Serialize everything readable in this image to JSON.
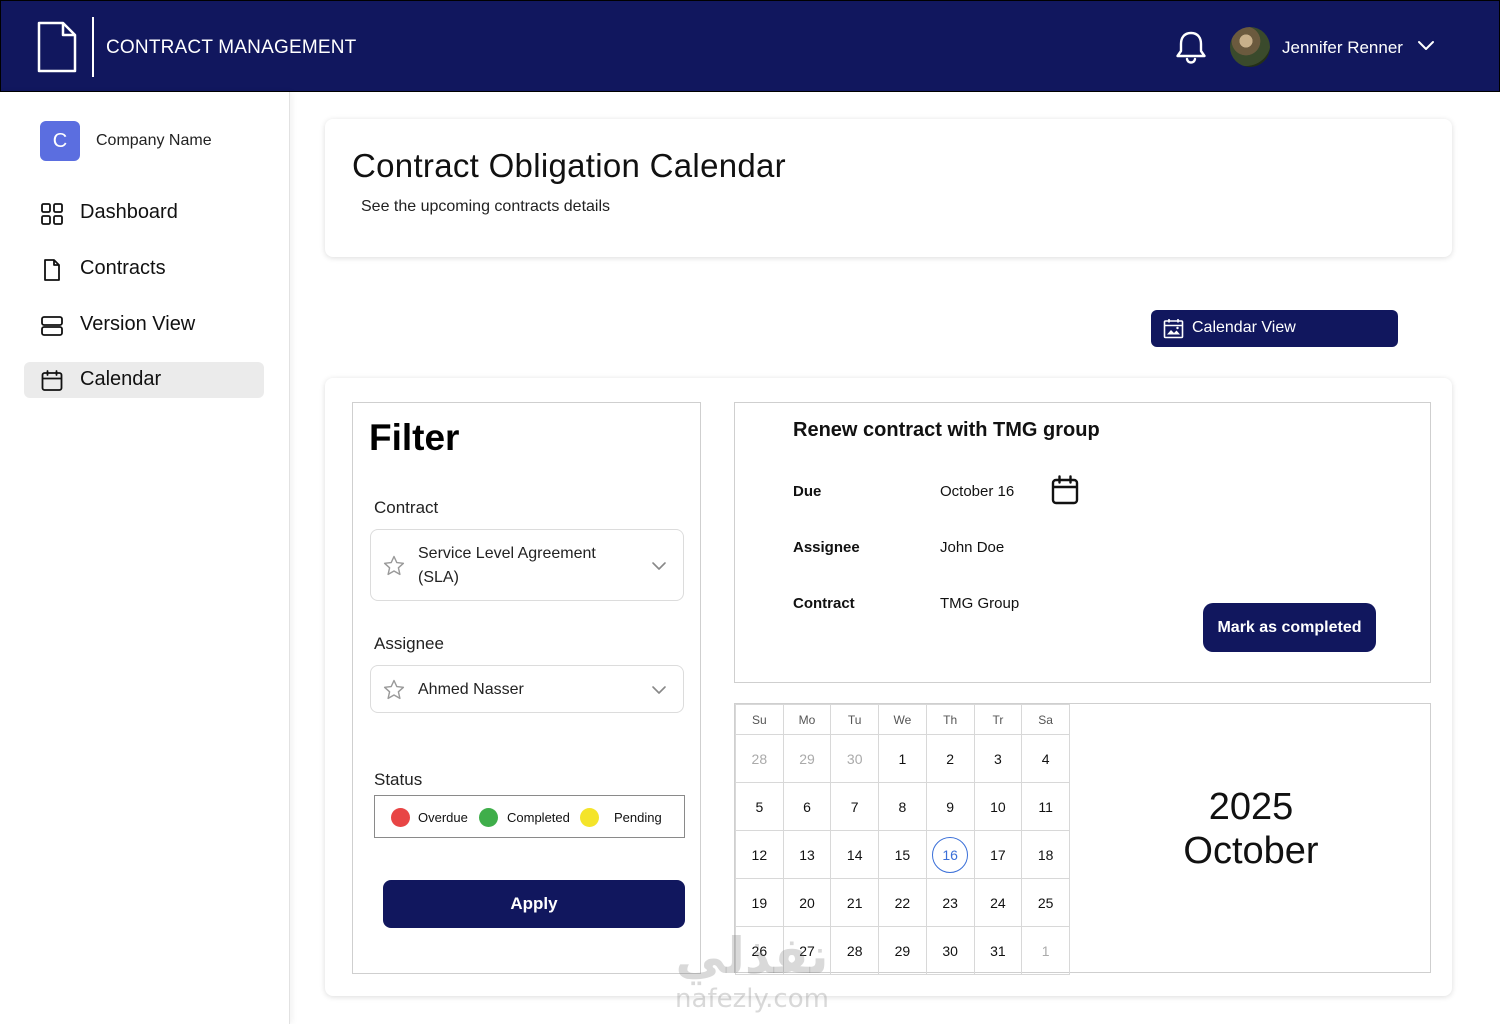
{
  "header": {
    "app_title": "CONTRACT MANAGEMENT",
    "user_name": "Jennifer Renner",
    "brand_color": "#11175e"
  },
  "sidebar": {
    "company_initial": "C",
    "company_name": "Company Name",
    "items": [
      {
        "label": "Dashboard",
        "icon": "grid-icon"
      },
      {
        "label": "Contracts",
        "icon": "document-icon"
      },
      {
        "label": "Version View",
        "icon": "stack-icon"
      },
      {
        "label": "Calendar",
        "icon": "calendar-icon",
        "active": true
      }
    ]
  },
  "page": {
    "title": "Contract Obligation Calendar",
    "subtitle": "See the upcoming contracts details",
    "calendar_view_label": "Calendar View"
  },
  "filter": {
    "title": "Filter",
    "contract_label": "Contract",
    "contract_value_line1": "Service Level Agreement",
    "contract_value_line2": "(SLA)",
    "assignee_label": "Assignee",
    "assignee_value": "Ahmed Nasser",
    "status_label": "Status",
    "statuses": [
      {
        "label": "Overdue",
        "color": "#e84545"
      },
      {
        "label": "Completed",
        "color": "#3fae4a"
      },
      {
        "label": "Pending",
        "color": "#f4e42a"
      }
    ],
    "apply_label": "Apply"
  },
  "detail": {
    "title": "Renew contract with TMG group",
    "due_label": "Due",
    "due_value": "October 16",
    "assignee_label": "Assignee",
    "assignee_value": "John Doe",
    "contract_label": "Contract",
    "contract_value": "TMG Group",
    "mark_label": "Mark as completed"
  },
  "calendar": {
    "weekdays": [
      "Su",
      "Mo",
      "Tu",
      "We",
      "Th",
      "Tr",
      "Sa"
    ],
    "weeks": [
      [
        "28",
        "29",
        "30",
        "1",
        "2",
        "3",
        "4"
      ],
      [
        "5",
        "6",
        "7",
        "8",
        "9",
        "10",
        "11"
      ],
      [
        "12",
        "13",
        "14",
        "15",
        "16",
        "17",
        "18"
      ],
      [
        "19",
        "20",
        "21",
        "22",
        "23",
        "24",
        "25"
      ],
      [
        "26",
        "27",
        "28",
        "29",
        "30",
        "31",
        "1"
      ]
    ],
    "selected_day": "16",
    "year": "2025",
    "month": "October"
  },
  "watermark": {
    "arabic": "نفذلي",
    "latin": "nafezly.com"
  }
}
